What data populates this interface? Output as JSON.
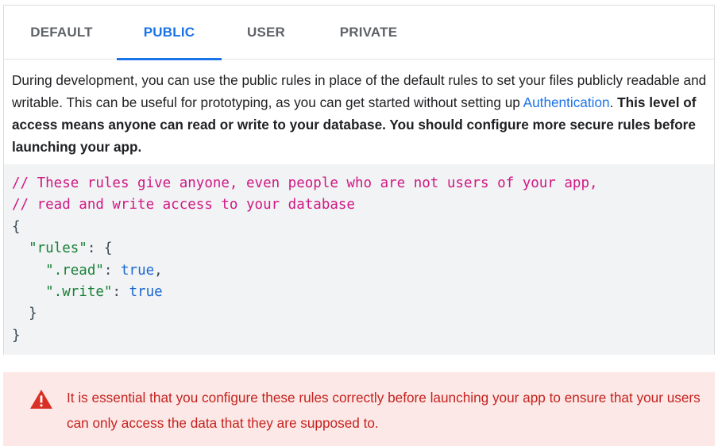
{
  "tabs": [
    {
      "label": "DEFAULT",
      "active": false
    },
    {
      "label": "PUBLIC",
      "active": true
    },
    {
      "label": "USER",
      "active": false
    },
    {
      "label": "PRIVATE",
      "active": false
    }
  ],
  "description": {
    "text_before_link": "During development, you can use the public rules in place of the default rules to set your files publicly readable and writable. This can be useful for prototyping, as you can get started without setting up ",
    "link": "Authentication",
    "text_after_link": ". ",
    "bold_text": "This level of access means anyone can read or write to your database. You should configure more secure rules before launching your app."
  },
  "code": {
    "comment_1": "// These rules give anyone, even people who are not users of your app,",
    "comment_2": "// read and write access to your database",
    "open_brace": "{",
    "rules_key": "\"rules\"",
    "rules_open": ": {",
    "read_key": "\".read\"",
    "read_colon": ": ",
    "read_value": "true",
    "read_comma": ",",
    "write_key": "\".write\"",
    "write_colon": ": ",
    "write_value": "true",
    "inner_close": "}",
    "close_brace": "}"
  },
  "warning": {
    "icon": "warning-triangle-icon",
    "text": "It is essential that you configure these rules correctly before launching your app to ensure that your users can only access the data that they are supposed to."
  },
  "colors": {
    "accent": "#1a73e8",
    "comment": "#d01884",
    "string": "#188038",
    "boolean": "#1967d2",
    "warning_bg": "#fce8e6",
    "warning_text": "#c5221f"
  }
}
